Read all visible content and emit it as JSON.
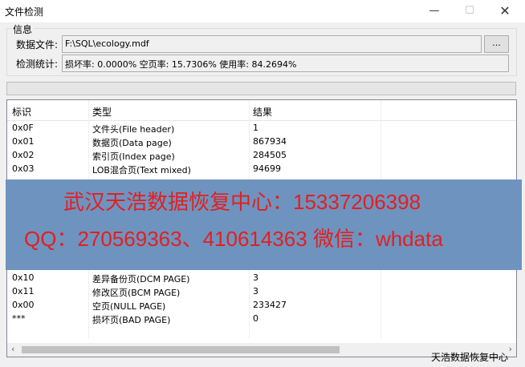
{
  "window": {
    "title": "文件检测",
    "min": "—",
    "max": "☐",
    "close": "✕"
  },
  "info": {
    "legend": "信息",
    "file_label": "数据文件:",
    "file_value": "F:\\SQL\\ecology.mdf",
    "browse_label": "...",
    "stat_label": "检测统计:",
    "stat_value": "损坏率: 0.0000%  空页率: 15.7306%  使用率: 84.2694%"
  },
  "progress": {
    "value": 0
  },
  "table": {
    "headers": [
      "标识",
      "类型",
      "结果"
    ],
    "rows_top": [
      [
        "0x0F",
        "文件头(File header)",
        "1"
      ],
      [
        "0x01",
        "数据页(Data page)",
        "867934"
      ],
      [
        "0x02",
        "索引页(Index page)",
        "284505"
      ],
      [
        "0x03",
        "LOB混合页(Text mixed)",
        "94699"
      ]
    ],
    "rows_bottom": [
      [
        "0x10",
        "差异备份页(DCM PAGE)",
        "3"
      ],
      [
        "0x11",
        "修改区页(BCM PAGE)",
        "3"
      ],
      [
        "0x00",
        "空页(NULL PAGE)",
        "233427"
      ],
      [
        "***",
        "损坏页(BAD PAGE)",
        "0"
      ]
    ],
    "scroll_left": "‹",
    "scroll_right": "›"
  },
  "watermark": {
    "line1": "武汉天浩数据恢复中心：15337206398",
    "line2": "QQ：270569363、410614363   微信：whdata",
    "text_color": "#e02020",
    "bg_color": "#6f93bf"
  },
  "footer": {
    "text": "天浩数据恢复中心"
  }
}
